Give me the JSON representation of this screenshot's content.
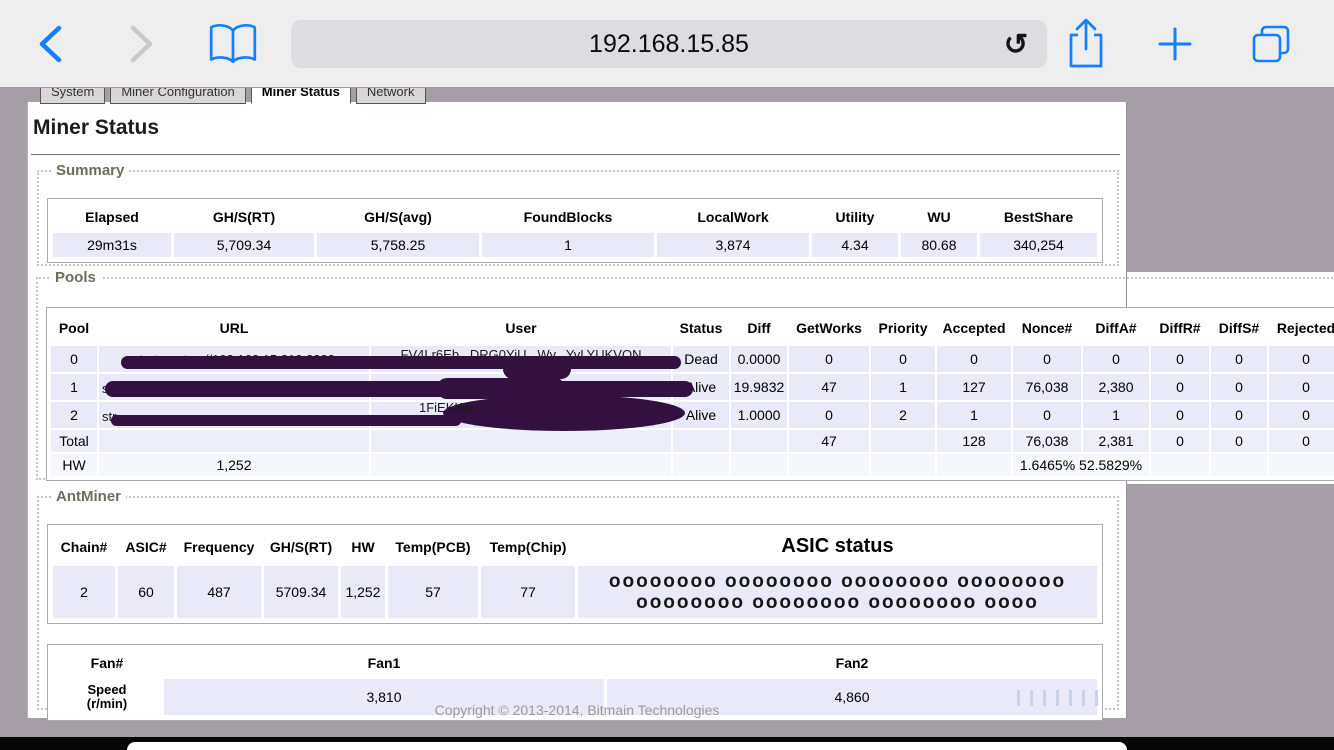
{
  "browser": {
    "url": "192.168.15.85",
    "icons": {
      "back": "back-chevron",
      "forward": "forward-chevron",
      "bookmarks": "open-book",
      "reload_glyph": "↻",
      "share": "share-box-arrow",
      "new_tab": "plus",
      "tabs": "overlapping-squares"
    }
  },
  "tabs": [
    {
      "label": "System",
      "active": false
    },
    {
      "label": "Miner Configuration",
      "active": false
    },
    {
      "label": "Miner Status",
      "active": true
    },
    {
      "label": "Network",
      "active": false
    }
  ],
  "page": {
    "title": "Miner Status",
    "footer": "Copyright © 2013-2014, Bitmain Technologies"
  },
  "summary": {
    "legend": "Summary",
    "headers": [
      "Elapsed",
      "GH/S(RT)",
      "GH/S(avg)",
      "FoundBlocks",
      "LocalWork",
      "Utility",
      "WU",
      "BestShare"
    ],
    "values": [
      "29m31s",
      "5,709.34",
      "5,758.25",
      "1",
      "3,874",
      "4.34",
      "80.68",
      "340,254"
    ]
  },
  "pools": {
    "legend": "Pools",
    "headers": [
      "Pool",
      "URL",
      "User",
      "Status",
      "Diff",
      "GetWorks",
      "Priority",
      "Accepted",
      "Nonce#",
      "DiffA#",
      "DiffR#",
      "DiffS#",
      "Rejected"
    ],
    "rows": [
      {
        "pool": "0",
        "url_fragment": "stratum+tcp://192.168.15.210:3333",
        "user_fragment": "FV4Lr6Eb...DRG0YiU...Wy...YvLYUKVQN",
        "status": "Dead",
        "diff": "0.0000",
        "getworks": "0",
        "priority": "0",
        "accepted": "0",
        "nonce": "0",
        "diffa": "0",
        "diffr": "0",
        "diffs": "0",
        "rejected": "0",
        "redacted": true
      },
      {
        "pool": "1",
        "url_fragment": "s",
        "user_fragment": "",
        "status": "Alive",
        "diff": "19.9832",
        "getworks": "47",
        "priority": "1",
        "accepted": "127",
        "nonce": "76,038",
        "diffa": "2,380",
        "diffr": "0",
        "diffs": "0",
        "rejected": "0",
        "redacted": true
      },
      {
        "pool": "2",
        "url_fragment": "str",
        "user_fragment": "1FiEKKw...",
        "status": "Alive",
        "diff": "1.0000",
        "getworks": "0",
        "priority": "2",
        "accepted": "1",
        "nonce": "0",
        "diffa": "1",
        "diffr": "0",
        "diffs": "0",
        "rejected": "0",
        "redacted": true
      }
    ],
    "total_row": {
      "label": "Total",
      "url": "",
      "user": "",
      "status": "",
      "diff": "",
      "getworks": "47",
      "priority": "",
      "accepted": "128",
      "nonce": "76,038",
      "diffa": "2,381",
      "diffr": "0",
      "diffs": "0",
      "rejected": "0"
    },
    "hw_row": {
      "label": "HW",
      "url_value": "1,252",
      "user": "",
      "status": "",
      "diff": "",
      "getworks": "",
      "priority": "",
      "accepted": "",
      "pct1": "1.6465%",
      "pct2": "52.5829%",
      "diffr": "",
      "diffs": "",
      "rejected": ""
    }
  },
  "antminer": {
    "legend": "AntMiner",
    "headers": [
      "Chain#",
      "ASIC#",
      "Frequency",
      "GH/S(RT)",
      "HW",
      "Temp(PCB)",
      "Temp(Chip)",
      "ASIC status"
    ],
    "row": {
      "chain": "2",
      "asic": "60",
      "frequency": "487",
      "ghs_rt": "5709.34",
      "hw": "1,252",
      "temp_pcb": "57",
      "temp_chip": "77",
      "asic_status_line1": "oooooooo oooooooo oooooooo oooooooo",
      "asic_status_line2": "oooooooo oooooooo oooooooo oooo"
    },
    "fan": {
      "headers": [
        "Fan#",
        "Fan1",
        "Fan2"
      ],
      "row_label_line1": "Speed",
      "row_label_line2": "(r/min)",
      "values": [
        "3,810",
        "4,860"
      ]
    }
  },
  "colors": {
    "accent_blue": "#157efb",
    "cell_lavender": "#e9e9f7",
    "redaction_purple": "#321040",
    "page_background": "#a59ea7"
  }
}
